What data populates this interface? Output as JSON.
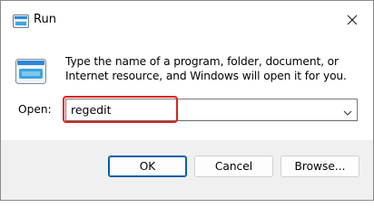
{
  "window": {
    "title": "Run",
    "app_icon": "run-icon",
    "close_icon": "close-icon"
  },
  "content": {
    "icon": "run-large-icon",
    "description": "Type the name of a program, folder, document, or Internet resource, and Windows will open it for you.",
    "open_label": "Open:",
    "open_value": "regedit",
    "dropdown_icon": "chevron-down-icon",
    "highlight_color": "#e02020"
  },
  "buttons": {
    "ok": "OK",
    "cancel": "Cancel",
    "browse": "Browse..."
  },
  "colors": {
    "accent": "#0067c0",
    "highlight": "#e02020"
  }
}
